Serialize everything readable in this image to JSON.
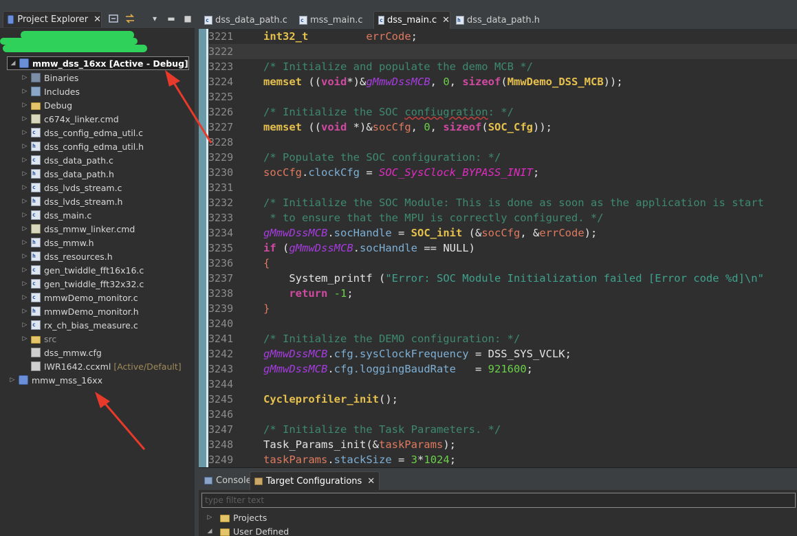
{
  "project_explorer": {
    "tab_title": "Project Explorer",
    "tree": [
      {
        "label": "mmw_dss_16xx  [Active - Debug]",
        "icon": "project-icon",
        "level": 0,
        "expanded": true,
        "selected": true
      },
      {
        "label": "Binaries",
        "icon": "binaries-icon",
        "level": 1
      },
      {
        "label": "Includes",
        "icon": "includes-icon",
        "level": 1
      },
      {
        "label": "Debug",
        "icon": "folder-icon",
        "level": 1
      },
      {
        "label": "c674x_linker.cmd",
        "icon": "cmd-file-icon",
        "level": 1
      },
      {
        "label": "dss_config_edma_util.c",
        "icon": "c-file-icon",
        "level": 1
      },
      {
        "label": "dss_config_edma_util.h",
        "icon": "h-file-icon",
        "level": 1
      },
      {
        "label": "dss_data_path.c",
        "icon": "c-file-icon",
        "level": 1
      },
      {
        "label": "dss_data_path.h",
        "icon": "h-file-icon",
        "level": 1
      },
      {
        "label": "dss_lvds_stream.c",
        "icon": "c-file-icon",
        "level": 1
      },
      {
        "label": "dss_lvds_stream.h",
        "icon": "h-file-icon",
        "level": 1
      },
      {
        "label": "dss_main.c",
        "icon": "c-file-icon",
        "level": 1
      },
      {
        "label": "dss_mmw_linker.cmd",
        "icon": "cmd-file-icon",
        "level": 1
      },
      {
        "label": "dss_mmw.h",
        "icon": "h-file-icon",
        "level": 1
      },
      {
        "label": "dss_resources.h",
        "icon": "h-file-icon",
        "level": 1
      },
      {
        "label": "gen_twiddle_fft16x16.c",
        "icon": "c-file-icon",
        "level": 1
      },
      {
        "label": "gen_twiddle_fft32x32.c",
        "icon": "c-file-icon",
        "level": 1
      },
      {
        "label": "mmwDemo_monitor.c",
        "icon": "c-file-icon",
        "level": 1
      },
      {
        "label": "mmwDemo_monitor.h",
        "icon": "h-file-icon",
        "level": 1
      },
      {
        "label": "rx_ch_bias_measure.c",
        "icon": "c-file-icon",
        "level": 1
      },
      {
        "label": "src",
        "icon": "folder-icon",
        "level": 1,
        "dim": true
      },
      {
        "label": "dss_mmw.cfg",
        "icon": "cfg-file-icon",
        "level": 1,
        "noarrow": true
      },
      {
        "label": "IWR1642.ccxml",
        "decoration": "[Active/Default]",
        "icon": "ccxml-file-icon",
        "level": 1,
        "noarrow": true
      },
      {
        "label": "mmw_mss_16xx",
        "icon": "project-icon",
        "level": 0
      }
    ]
  },
  "editor": {
    "tabs": [
      {
        "label": "dss_data_path.c",
        "active": false
      },
      {
        "label": "mss_main.c",
        "active": false
      },
      {
        "label": "dss_main.c",
        "active": true
      },
      {
        "label": "dss_data_path.h",
        "active": false
      }
    ],
    "line_numbers": [
      "3221",
      "3222",
      "3223",
      "3224",
      "3225",
      "3226",
      "3227",
      "3228",
      "3229",
      "3230",
      "3231",
      "3232",
      "3233",
      "3234",
      "3235",
      "3236",
      "3237",
      "3238",
      "3239",
      "3240",
      "3241",
      "3242",
      "3243",
      "3244",
      "3245",
      "3246",
      "3247",
      "3248",
      "3249"
    ],
    "code": {
      "l3221_type": "int32_t",
      "l3221_var": "errCode",
      "l3223": "/* Initialize and populate the demo MCB */",
      "l3224_fn": "memset",
      "l3224_void": "void",
      "l3224_gl": "gMmwDssMCB",
      "l3224_zero": "0",
      "l3224_sizeof": "sizeof",
      "l3224_type": "MmwDemo_DSS_MCB",
      "l3226_a": "/* Initialize the SOC ",
      "l3226_b": "confiugration",
      "l3226_c": ": */",
      "l3227_fn": "memset",
      "l3227_void": "void",
      "l3227_var": "socCfg",
      "l3227_zero": "0",
      "l3227_sizeof": "sizeof",
      "l3227_type": "SOC_Cfg",
      "l3229": "/* Populate the SOC configuration: */",
      "l3230_var": "socCfg",
      "l3230_field": "clockCfg",
      "l3230_mac": "SOC_SysClock_BYPASS_INIT",
      "l3232": "/* Initialize the SOC Module: This is done as soon as the application is start",
      "l3233": " * to ensure that the MPU is correctly configured. */",
      "l3234_gl": "gMmwDssMCB",
      "l3234_field": "socHandle",
      "l3234_fn": "SOC_init",
      "l3234_a1": "socCfg",
      "l3234_a2": "errCode",
      "l3235_kw": "if",
      "l3235_gl": "gMmwDssMCB",
      "l3235_field": "socHandle",
      "l3235_null": "NULL",
      "l3236": "{",
      "l3237_fn": "System_printf",
      "l3237_str": "\"Error: SOC Module Initialization failed [Error code %d]\\n\"",
      "l3238_kw": "return",
      "l3238_num": "-1",
      "l3239": "}",
      "l3241": "/* Initialize the DEMO configuration: */",
      "l3242_gl": "gMmwDssMCB",
      "l3242_field": "cfg.sysClockFrequency",
      "l3242_val": "DSS_SYS_VCLK",
      "l3243_gl": "gMmwDssMCB",
      "l3243_field": "cfg.loggingBaudRate",
      "l3243_num": "921600",
      "l3245_fn": "Cycleprofiler_init",
      "l3247": "/* Initialize the Task Parameters. */",
      "l3248_fn": "Task_Params_init",
      "l3248_var": "taskParams",
      "l3249_var": "taskParams",
      "l3249_field": "stackSize",
      "l3249_num1": "3",
      "l3249_num2": "1024"
    }
  },
  "bottom_panel": {
    "tabs": [
      {
        "label": "Console",
        "active": false
      },
      {
        "label": "Target Configurations",
        "active": true
      }
    ],
    "filter_placeholder": "type filter text",
    "tree": [
      {
        "label": "Projects",
        "expanded": false
      },
      {
        "label": "User Defined",
        "expanded": true
      }
    ]
  },
  "colors": {
    "annotation_arrow": "#e83a2a",
    "redaction_scribble": "#2fd15a"
  }
}
